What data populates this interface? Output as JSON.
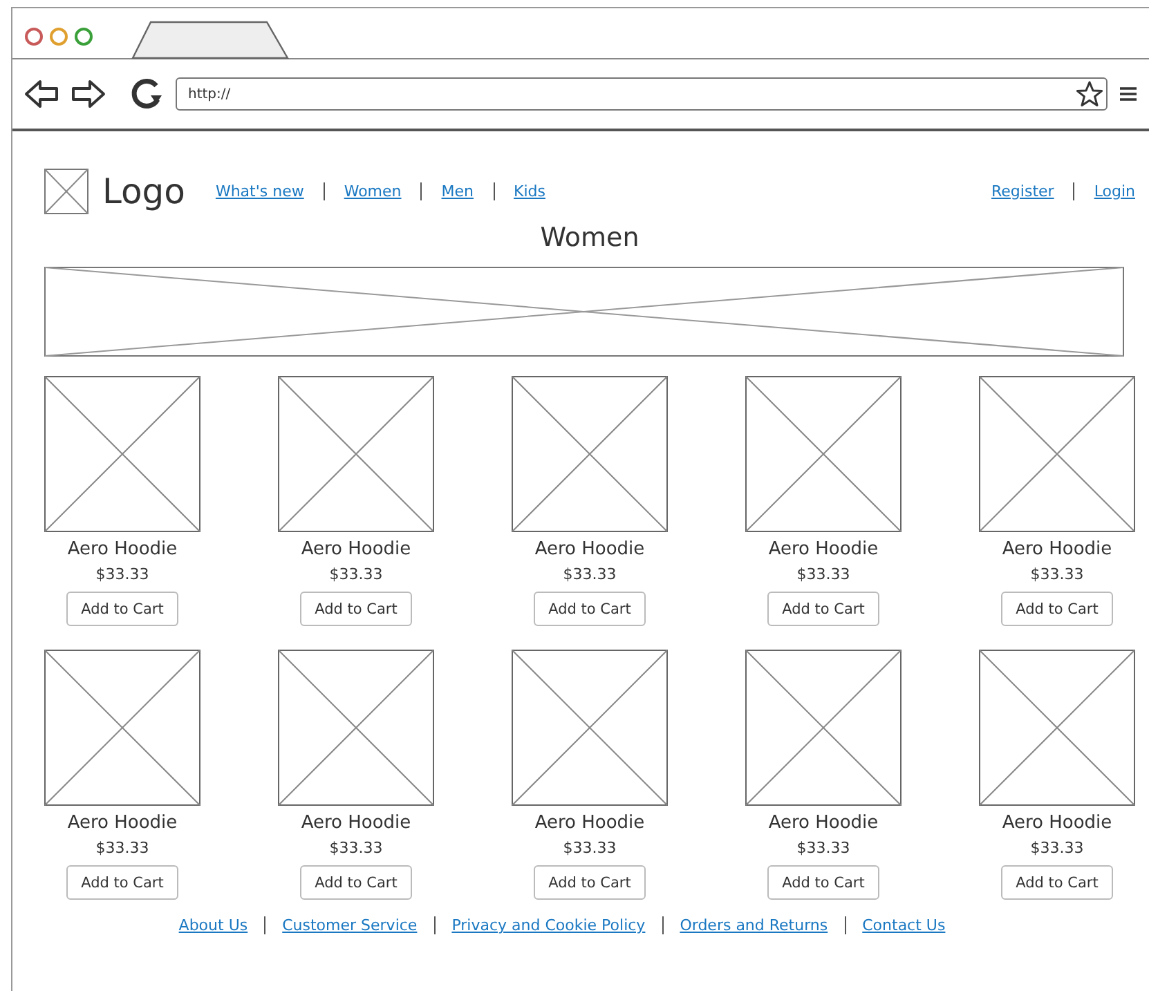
{
  "browser": {
    "url": "http://"
  },
  "header": {
    "logo": "Logo",
    "nav": [
      "What's new",
      "Women",
      "Men",
      "Kids"
    ],
    "account": [
      "Register",
      "Login"
    ]
  },
  "page_title": "Women",
  "products": [
    {
      "name": "Aero Hoodie",
      "price": "$33.33",
      "button": "Add to Cart"
    },
    {
      "name": "Aero Hoodie",
      "price": "$33.33",
      "button": "Add to Cart"
    },
    {
      "name": "Aero Hoodie",
      "price": "$33.33",
      "button": "Add to Cart"
    },
    {
      "name": "Aero Hoodie",
      "price": "$33.33",
      "button": "Add to Cart"
    },
    {
      "name": "Aero Hoodie",
      "price": "$33.33",
      "button": "Add to Cart"
    },
    {
      "name": "Aero Hoodie",
      "price": "$33.33",
      "button": "Add to Cart"
    },
    {
      "name": "Aero Hoodie",
      "price": "$33.33",
      "button": "Add to Cart"
    },
    {
      "name": "Aero Hoodie",
      "price": "$33.33",
      "button": "Add to Cart"
    },
    {
      "name": "Aero Hoodie",
      "price": "$33.33",
      "button": "Add to Cart"
    },
    {
      "name": "Aero Hoodie",
      "price": "$33.33",
      "button": "Add to Cart"
    }
  ],
  "footer": [
    "About Us",
    "Customer Service",
    "Privacy and Cookie Policy",
    "Orders and Returns",
    "Contact Us"
  ]
}
